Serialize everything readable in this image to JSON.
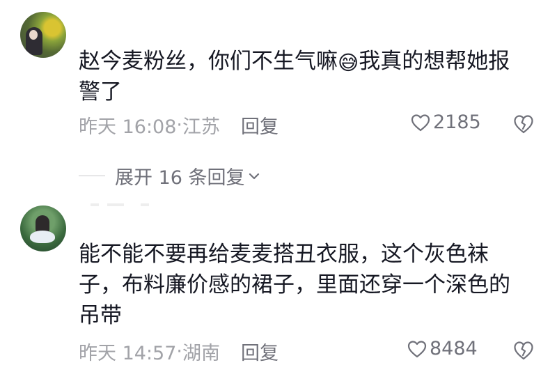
{
  "comments": [
    {
      "text_before_emoji": "赵今麦粉丝，你们不生气嘛",
      "emoji": "😅",
      "text_after_emoji": "我真的想帮她报警了",
      "time": "昨天 16:08",
      "location_sep": "·",
      "location": "江苏",
      "reply_label": "回复",
      "likes": "2185",
      "expand_label": "展开 16 条回复"
    },
    {
      "text": "能不能不要再给麦麦搭丑衣服，这个灰色袜子，布料廉价感的裙子，里面还穿一个深色的吊带",
      "time": "昨天 14:57",
      "location_sep": "·",
      "location": "湖南",
      "reply_label": "回复",
      "likes": "8484"
    }
  ],
  "icons": {
    "like": "heart-outline-icon",
    "dislike": "broken-heart-icon",
    "expand": "chevron-down-icon"
  },
  "colors": {
    "text_primary": "#161823",
    "text_meta": "#a2a3a8",
    "text_secondary": "#70717a"
  }
}
